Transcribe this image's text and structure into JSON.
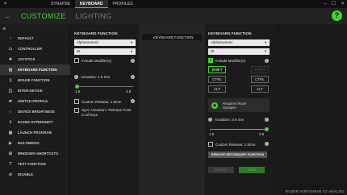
{
  "topbar": {
    "tabs": [
      "SYNAPSE",
      "KEYBOARD",
      "PROFILES"
    ],
    "active_tab": 1,
    "controls": [
      "–",
      "☐",
      "✕"
    ]
  },
  "header": {
    "tabs": [
      "CUSTOMIZE",
      "LIGHTING"
    ],
    "help": "?"
  },
  "sidebar": {
    "items": [
      {
        "label": "DEFAULT",
        "icon": "circle-icon"
      },
      {
        "label": "CONTROLLER",
        "icon": "gamepad-icon"
      },
      {
        "label": "JOYSTICK",
        "icon": "joystick-icon"
      },
      {
        "label": "KEYBOARD FUNCTION",
        "icon": "keyboard-icon"
      },
      {
        "label": "MOUSE FUNCTION",
        "icon": "mouse-icon"
      },
      {
        "label": "INTER-DEVICE",
        "icon": "devices-icon"
      },
      {
        "label": "SWITCH PROFILE",
        "icon": "switch-icon"
      },
      {
        "label": "DEVICE BRIGHTNESS",
        "icon": "brightness-icon"
      },
      {
        "label": "RAZER HYPERSHIFT",
        "icon": "hypershift-icon"
      },
      {
        "label": "LAUNCH PROGRAM",
        "icon": "launch-icon"
      },
      {
        "label": "MULTIMEDIA",
        "icon": "multimedia-icon"
      },
      {
        "label": "WINDOWS SHORTCUTS",
        "icon": "windows-icon"
      },
      {
        "label": "TEXT FUNCTION",
        "icon": "text-icon"
      },
      {
        "label": "DISABLE",
        "icon": "disable-icon"
      }
    ],
    "active_index": 3
  },
  "primary": {
    "title": "KEYBOARD FUNCTION",
    "mode": "Alphanumeric",
    "key": "W",
    "include_modifiers": "Include Modifier(s)",
    "actuation_label": "Actuation: 1.5 mm",
    "slider_min": "1.5",
    "slider_max": "3.6",
    "slider_value": 0.0,
    "custom_release": "Custom Release: 1.5mm",
    "sync": "Sync Actuation / Release Point to all keys"
  },
  "middle": {
    "title": "KEYBOARD FUNCTION"
  },
  "secondary": {
    "title": "KEYBOARD FUNCTION",
    "mode": "Alphanumeric",
    "key": "W",
    "include_modifiers": "Include Modifier(s)",
    "modifiers": [
      "SHIFT",
      "SHIFT",
      "CTRL",
      "CTRL",
      "ALT",
      "ALT"
    ],
    "synapse_note": "Requires Razer Synapse",
    "actuation_label": "Actuation: 3.6 mm",
    "slider_min": "1.5",
    "slider_max": "3.6",
    "slider_value": 1.0,
    "custom_release": "Custom Release: 2.5mm",
    "remove_button": "REMOVE SECONDARY FUNCTION",
    "cancel": "CANCEL",
    "save": "SAVE"
  },
  "device_name": "RAZER HUNTSMAN V2 ANALOG",
  "colors": {
    "accent": "#44d62c"
  }
}
